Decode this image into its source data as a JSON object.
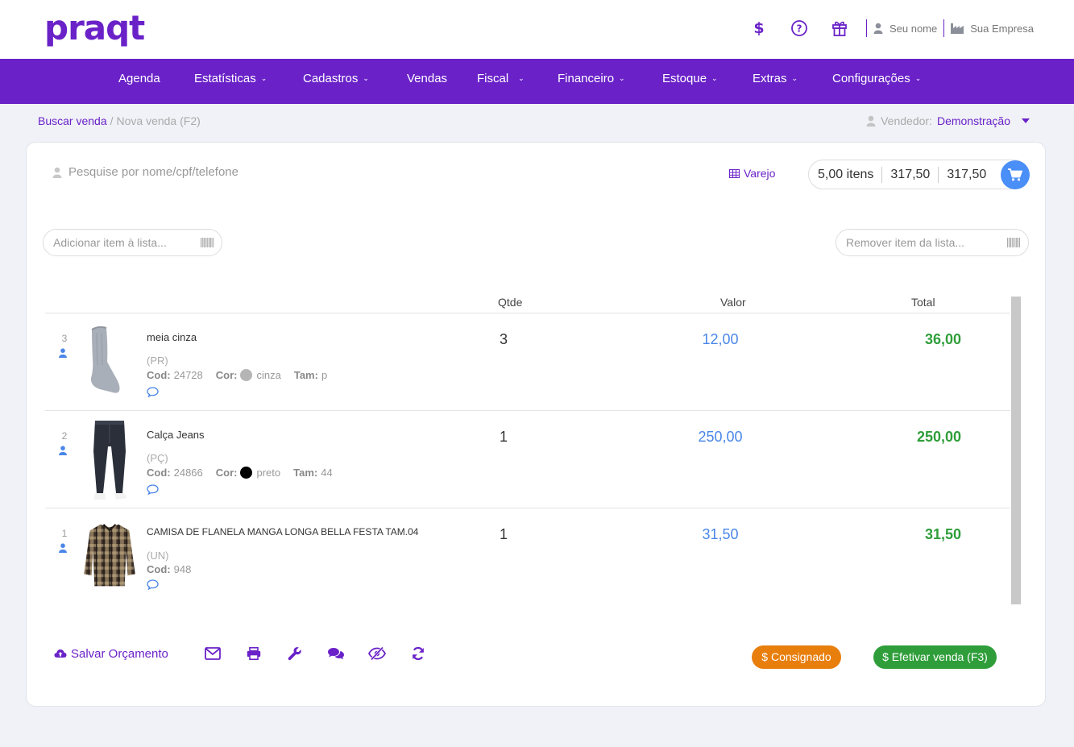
{
  "brand": "praqt",
  "header": {
    "user_name": "Seu nome",
    "company": "Sua Empresa"
  },
  "nav": [
    {
      "label": "Agenda",
      "dropdown": false
    },
    {
      "label": "Estatísticas",
      "dropdown": true
    },
    {
      "label": "Cadastros",
      "dropdown": true
    },
    {
      "label": "Vendas",
      "dropdown": false
    },
    {
      "label": "Fiscal",
      "dropdown": true
    },
    {
      "label": "Financeiro",
      "dropdown": true
    },
    {
      "label": "Estoque",
      "dropdown": true
    },
    {
      "label": "Extras",
      "dropdown": true
    },
    {
      "label": "Configurações",
      "dropdown": true
    }
  ],
  "breadcrumb": {
    "link": "Buscar venda",
    "current": "Nova venda (F2)"
  },
  "seller": {
    "label": "Vendedor:",
    "value": "Demonstração"
  },
  "customer_search": {
    "placeholder": "Pesquise por nome/cpf/telefone"
  },
  "price_table": "Varejo",
  "totals": {
    "items": "5,00 itens",
    "subtotal": "317,50",
    "total": "317,50"
  },
  "add_item": {
    "placeholder": "Adicionar item à lista..."
  },
  "remove_item": {
    "placeholder": "Remover item da lista..."
  },
  "columns": {
    "qty": "Qtde",
    "value": "Valor",
    "total": "Total"
  },
  "items": [
    {
      "index": "3",
      "name": "meia cinza",
      "unit": "(PR)",
      "cod_label": "Cod:",
      "cod": "24728",
      "cor_label": "Cor:",
      "cor": "cinza",
      "cor_hex": "#b5b5b5",
      "tam_label": "Tam:",
      "tam": "p",
      "qty": "3",
      "value": "12,00",
      "total": "36,00",
      "thumb": "sock"
    },
    {
      "index": "2",
      "name": "Calça Jeans",
      "unit": "(PÇ)",
      "cod_label": "Cod:",
      "cod": "24866",
      "cor_label": "Cor:",
      "cor": "preto",
      "cor_hex": "#000000",
      "tam_label": "Tam:",
      "tam": "44",
      "qty": "1",
      "value": "250,00",
      "total": "250,00",
      "thumb": "jeans"
    },
    {
      "index": "1",
      "name": "CAMISA DE FLANELA MANGA LONGA BELLA FESTA TAM.04",
      "unit": "(UN)",
      "cod_label": "Cod:",
      "cod": "948",
      "qty": "1",
      "value": "31,50",
      "total": "31,50",
      "thumb": "flannel-shirt"
    }
  ],
  "actions": {
    "save_budget": "Salvar Orçamento"
  },
  "buttons": {
    "consignado": "$ Consignado",
    "efetivar": "$ Efetivar venda (F3)"
  },
  "colors": {
    "brand": "#6a22c8",
    "value_blue": "#4a86e8",
    "total_green": "#2f9e3a",
    "orange": "#e87e0c",
    "cart_blue": "#4a8ef7"
  }
}
